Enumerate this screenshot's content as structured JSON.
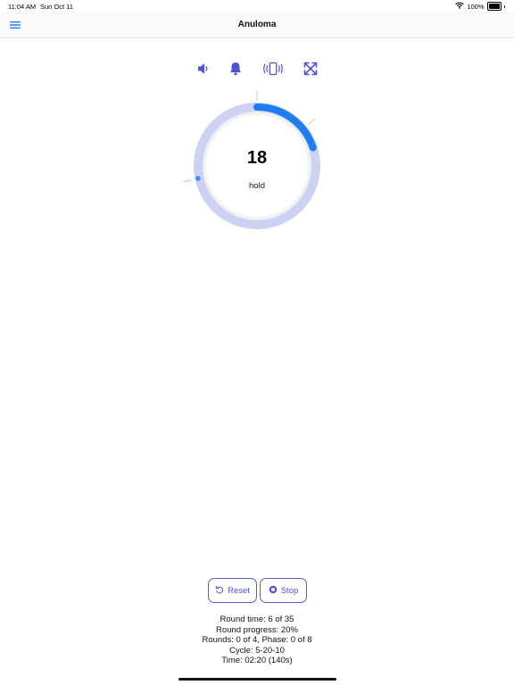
{
  "status_bar": {
    "time": "11:04 AM",
    "date": "Sun Oct 11",
    "battery": "100%",
    "battery_level": 1.0
  },
  "nav": {
    "title": "Anuloma",
    "menu_icon": "hamburger-menu-icon"
  },
  "toolbar": {
    "icons": [
      "speaker-icon",
      "bell-icon",
      "vibrate-icon",
      "fullscreen-icon"
    ],
    "accent_color": "#5252d4"
  },
  "timer": {
    "count": "18",
    "phase": "hold",
    "progress_fraction": 0.2,
    "progress_color": "#1e7df0",
    "track_color": "#cfd1f2"
  },
  "controls": {
    "reset_label": "Reset",
    "stop_label": "Stop",
    "border_color": "#5a5ad6"
  },
  "stats": {
    "round_time": "Round time: 6 of 35",
    "round_progress": "Round progress: 20%",
    "rounds_phase": "Rounds: 0 of 4, Phase: 0 of 8",
    "cycle": "Cycle: 5-20-10",
    "time": "Time: 02:20 (140s)"
  }
}
